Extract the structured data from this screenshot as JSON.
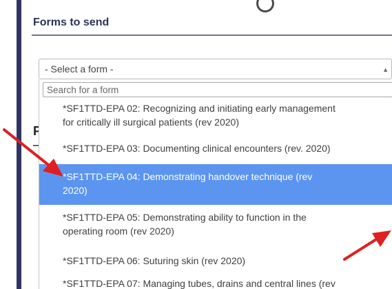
{
  "section": {
    "title": "Forms to send"
  },
  "hidden_label": "F",
  "select": {
    "value": "- Select a form -",
    "arrow": "▲"
  },
  "dropdown": {
    "search_placeholder": "Search for a form",
    "options": [
      {
        "line1": "*SF1TTD-EPA 02: Recognizing and initiating early management",
        "line2": "for critically ill surgical patients (rev 2020)"
      },
      {
        "line1": "*SF1TTD-EPA 03: Documenting clinical encounters (rev. 2020)"
      },
      {
        "line1": "*SF1TTD-EPA 04: Demonstrating handover technique (rev",
        "line2": "2020)",
        "selected": true
      },
      {
        "line1": "*SF1TTD-EPA 05: Demonstrating ability to function in the",
        "line2": "operating room (rev 2020)"
      },
      {
        "line1": "*SF1TTD-EPA 06: Suturing skin (rev 2020)"
      },
      {
        "line1": "*SF1TTD-EPA 07: Managing tubes, drains and central lines (rev"
      }
    ]
  },
  "colors": {
    "nav_bar": "#2e3466",
    "highlight": "#5c95f0",
    "annotation_arrow": "#e02020"
  }
}
